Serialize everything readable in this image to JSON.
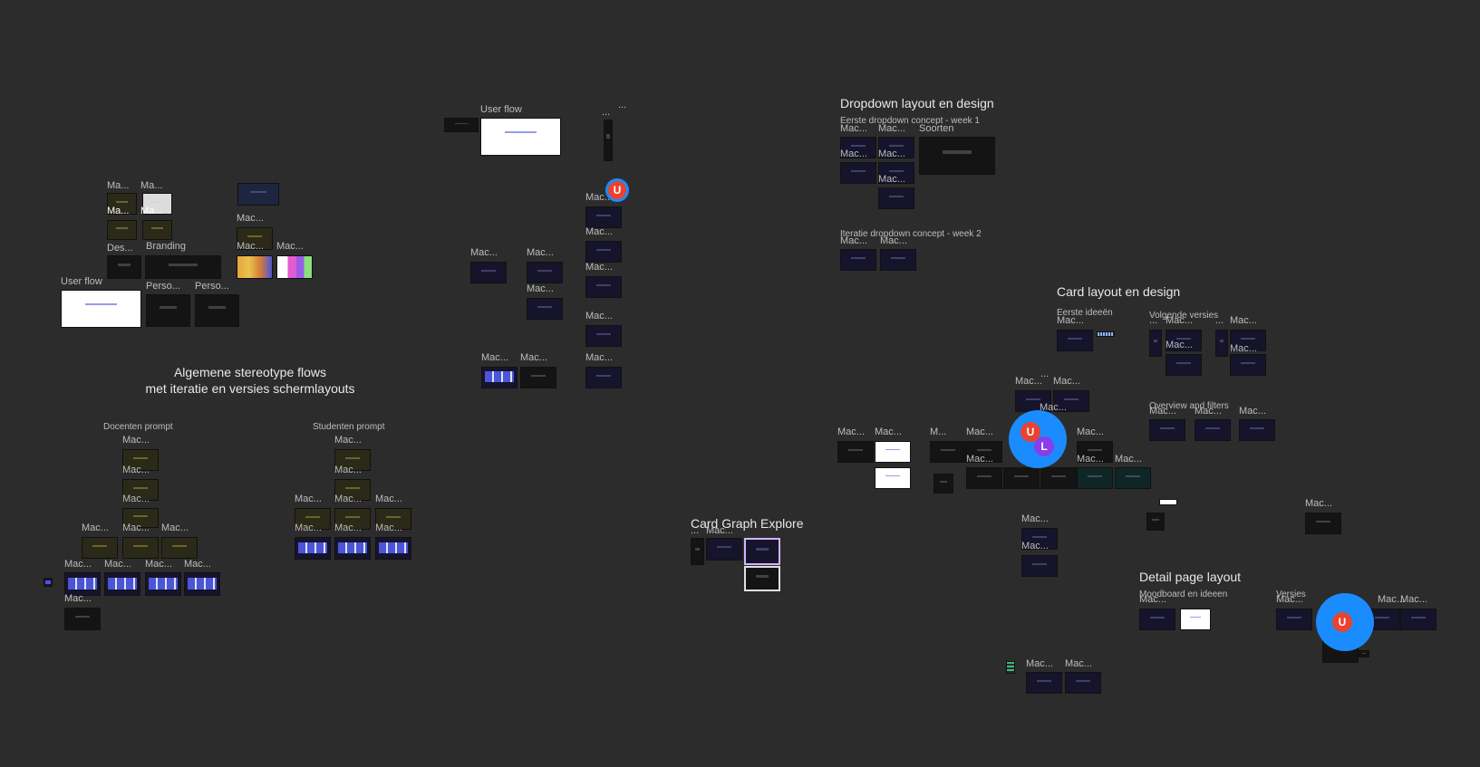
{
  "sections": {
    "stereotype_flows": "Algemene stereotype flows\nmet iteratie en versies schermlayouts",
    "docenten_prompt": "Docenten prompt",
    "studenten_prompt": "Studenten prompt",
    "user_flow_left": "User flow",
    "user_flow_mid": "User flow",
    "branding": "Branding",
    "dropdown": "Dropdown layout en design",
    "dropdown_week1": "Eerste dropdown concept - week 1",
    "soorten": "Soorten",
    "dropdown_week2": "Iteratie dropdown concept - week 2",
    "card_layout": "Card layout en design",
    "eerste_ideeen": "Eerste ideeën",
    "volgende_versies": "Volgende versies",
    "overview_filters": "Overview and filters",
    "card_graph": "Card Graph Explore",
    "detail_layout": "Detail page layout",
    "moodboard": "Moodboard en ideeen",
    "versies": "Versies"
  },
  "labels": {
    "mac": "Mac...",
    "ma": "Ma...",
    "des": "Des...",
    "perso": "Perso...",
    "m": "M...",
    "dots": "..."
  },
  "cursors": {
    "u": "U",
    "l": "L"
  },
  "colors": {
    "canvas": "#2c2c2c",
    "cursor_blue": "#1a8cff",
    "cursor_red": "#e8432f",
    "cursor_purple": "#8b3dea"
  }
}
